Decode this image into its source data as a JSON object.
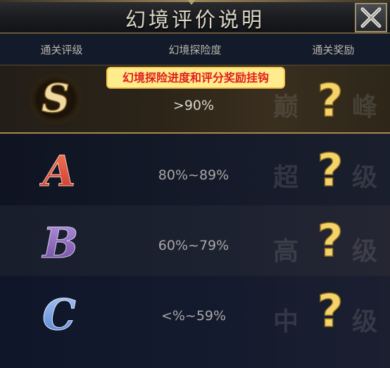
{
  "dialog": {
    "title": "幻境评价说明"
  },
  "headers": {
    "rank": "通关评级",
    "progress": "幻境探险度",
    "reward": "通关奖励"
  },
  "annotation": "幻境探险进度和评分奖励挂钩",
  "rows": [
    {
      "rank": "S",
      "range": ">90%",
      "title": [
        "巅",
        "峰"
      ],
      "reward_symbol": "?"
    },
    {
      "rank": "A",
      "range": "80%~89%",
      "title": [
        "超",
        "级"
      ],
      "reward_symbol": "?"
    },
    {
      "rank": "B",
      "range": "60%~79%",
      "title": [
        "高",
        "级"
      ],
      "reward_symbol": "?"
    },
    {
      "rank": "C",
      "range": "<%~59%",
      "title": [
        "中",
        "级"
      ],
      "reward_symbol": "?"
    }
  ],
  "colors": {
    "accent_gold": "#a88a4d",
    "question_gold": "#f3d36a",
    "annotation_bg": "#ffec8c",
    "annotation_text": "#e01e1e",
    "rank_s": "#f0d9a2",
    "rank_a": "#e5513f",
    "rank_b": "#8a64b8",
    "rank_c": "#6f9fe6"
  },
  "icons": {
    "close": "close-x-icon",
    "reward": "question-mark-icon"
  }
}
